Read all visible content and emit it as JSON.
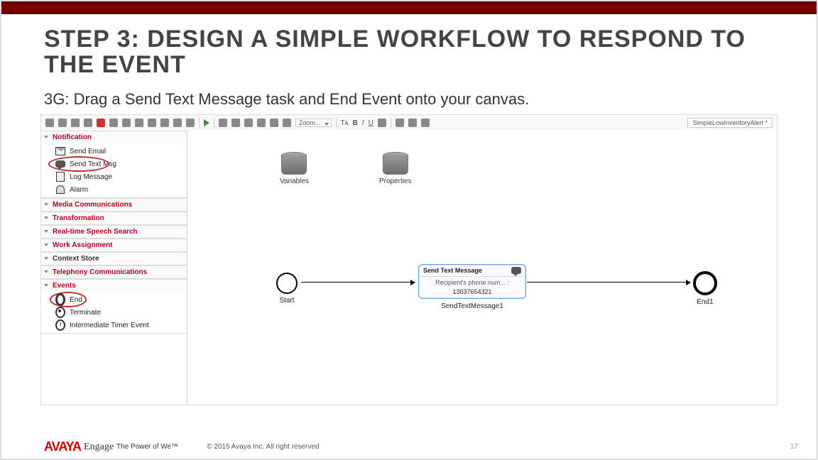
{
  "slide": {
    "title": "STEP 3: DESIGN A SIMPLE WORKFLOW TO RESPOND TO THE EVENT",
    "subtitle": "3G: Drag a Send Text Message task and End Event onto your canvas."
  },
  "toolbar": {
    "zoom": "Zoom...",
    "bold": "B",
    "italic": "I",
    "underline": "U",
    "font_ctrl": "Tᴀ",
    "file_tab": "SimpleLowInventoryAlert *"
  },
  "palette": {
    "groups": [
      {
        "name": "Notification",
        "items": [
          {
            "label": "Send Email",
            "icon": "envelope"
          },
          {
            "label": "Send Text Msg",
            "icon": "chat",
            "circled": true
          },
          {
            "label": "Log Message",
            "icon": "clipboard"
          },
          {
            "label": "Alarm",
            "icon": "bell"
          }
        ]
      },
      {
        "name": "Media Communications",
        "items": []
      },
      {
        "name": "Transformation",
        "items": []
      },
      {
        "name": "Real-time Speech Search",
        "items": []
      },
      {
        "name": "Work Assignment",
        "items": []
      },
      {
        "name": "Context Store",
        "items": []
      },
      {
        "name": "Telephony Communications",
        "items": []
      },
      {
        "name": "Events",
        "items": [
          {
            "label": "End",
            "icon": "end",
            "circled": true
          },
          {
            "label": "Terminate",
            "icon": "terminate"
          },
          {
            "label": "Intermediate Timer Event",
            "icon": "timer"
          }
        ]
      }
    ]
  },
  "canvas": {
    "datasources": [
      {
        "label": "Variables"
      },
      {
        "label": "Properties"
      }
    ],
    "start": {
      "label": "Start"
    },
    "end": {
      "label": "End1"
    },
    "task": {
      "title": "Send Text Message",
      "field": "Recipient's phone num... :",
      "value": "13037654321",
      "label": "SendTextMessage1"
    }
  },
  "footer": {
    "brand": "AVAYA",
    "engage": "Engage",
    "tagline": "The Power of We™",
    "copyright": "© 2015 Avaya Inc. All right reserved",
    "page": "17"
  }
}
